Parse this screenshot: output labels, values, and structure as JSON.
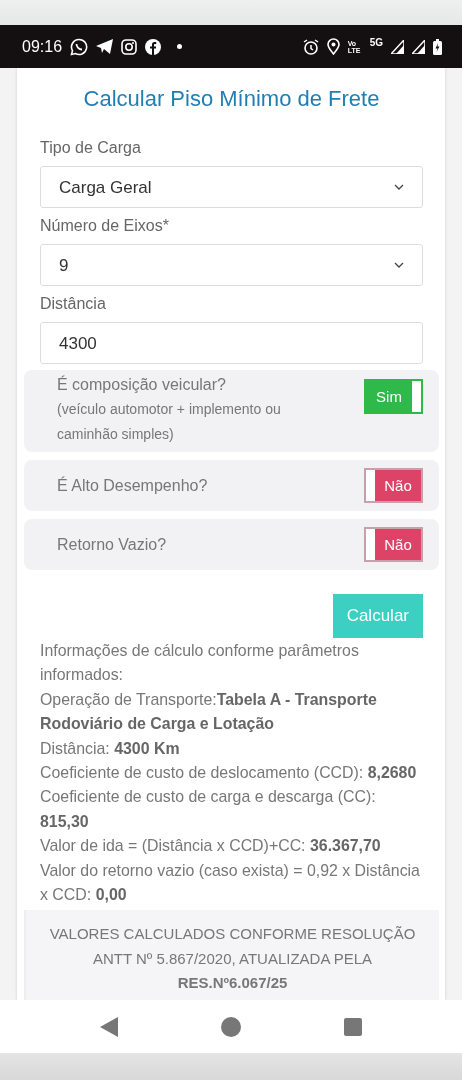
{
  "status_bar": {
    "time": "09:16",
    "network_texts": [
      "Vo LTE",
      "5G"
    ]
  },
  "title": "Calcular Piso Mínimo de Frete",
  "fields": [
    {
      "kind": "select",
      "label": "Tipo de Carga",
      "value": "Carga Geral"
    },
    {
      "kind": "select",
      "label": "Número de Eixos*",
      "value": "9"
    },
    {
      "kind": "input",
      "label": "Distância",
      "value": "4300"
    }
  ],
  "toggles": [
    {
      "label": "É composição veicular?",
      "note": "(veículo automotor + implemento ou caminhão simples)",
      "on": true,
      "text": "Sim"
    },
    {
      "label": "É Alto Desempenho?",
      "on": false,
      "text": "Não"
    },
    {
      "label": "Retorno Vazio?",
      "on": false,
      "text": "Não"
    }
  ],
  "button": "Calcular",
  "info_lines": [
    "Informações de cálculo conforme parâmetros informados:",
    "Operação de Transporte:**Tabela A - Transporte Rodoviário de Carga e Lotação**",
    "Distância: **4300 Km**",
    "Coeficiente de custo de deslocamento (CCD): **8,2680**",
    "Coeficiente de custo de carga e descarga (CC): **815,30**",
    "Valor de ida = (Distância x CCD)+CC: **36.367,70**",
    "Valor do retorno vazio (caso exista) = 0,92 x Distância x CCD: **0,00**"
  ],
  "notice": "VALORES CALCULADOS CONFORME RESOLUÇÃO ANTT Nº 5.867/2020, ATUALIZADA PELA **RES.Nº6.067/25**"
}
